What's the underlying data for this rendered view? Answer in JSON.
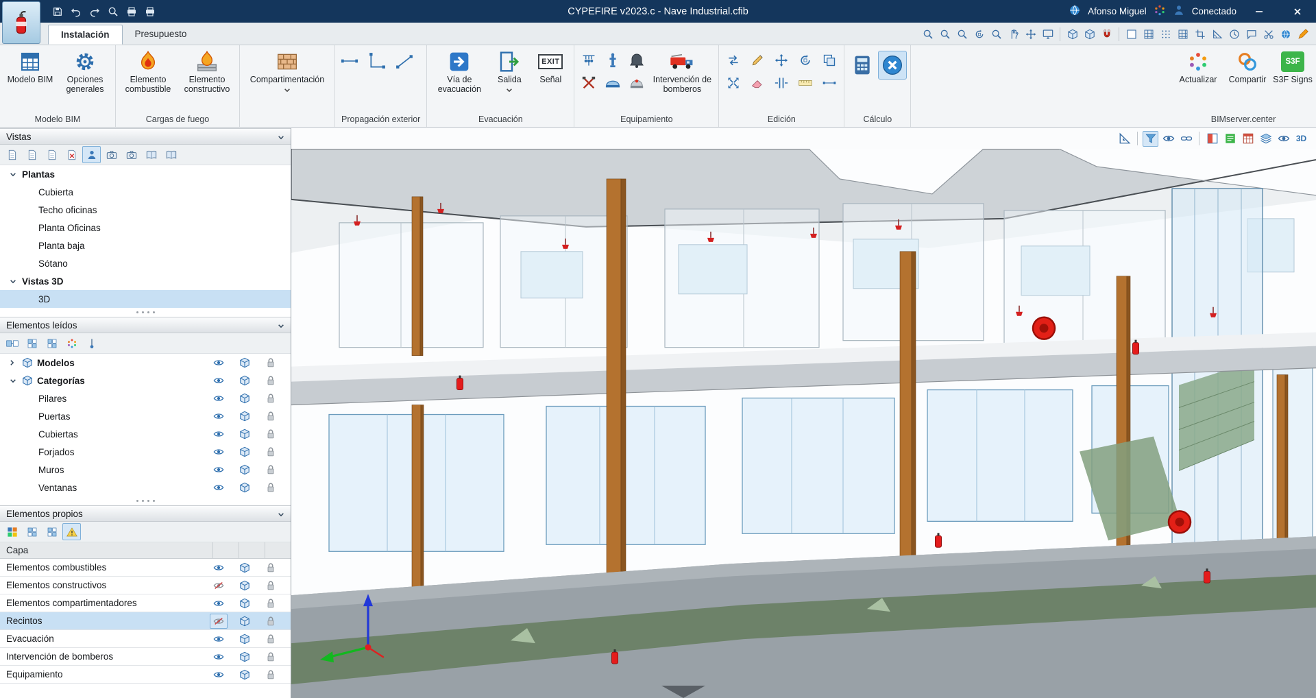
{
  "titlebar": {
    "title": "CYPEFIRE v2023.c - Nave Industrial.cfib",
    "user": "Afonso Miguel",
    "connection": "Conectado"
  },
  "tabs": {
    "instalacion": "Instalación",
    "presupuesto": "Presupuesto"
  },
  "ribbon": {
    "modelo_bim": {
      "label": "Modelo BIM",
      "btn_modelo": "Modelo BIM",
      "btn_opciones": "Opciones generales"
    },
    "cargas": {
      "label": "Cargas de fuego",
      "btn_combustible": "Elemento combustible",
      "btn_constructivo": "Elemento constructivo"
    },
    "compartimentacion": {
      "btn": "Compartimentación"
    },
    "propagacion": {
      "label": "Propagación exterior"
    },
    "evacuacion": {
      "label": "Evacuación",
      "btn_via": "Vía de evacuación",
      "btn_salida": "Salida",
      "btn_senal": "Señal",
      "exit_text": "EXIT"
    },
    "equipamiento": {
      "label": "Equipamiento",
      "btn_bomberos": "Intervención de bomberos"
    },
    "edicion": {
      "label": "Edición"
    },
    "calculo": {
      "label": "Cálculo"
    },
    "bimserver": {
      "label": "BIMserver.center",
      "btn_actualizar": "Actualizar",
      "btn_compartir": "Compartir",
      "btn_s3f": "S3F Signs",
      "s3f_badge": "S3F"
    }
  },
  "sidebar": {
    "vistas": {
      "title": "Vistas",
      "plantas_label": "Plantas",
      "plantas": [
        "Cubierta",
        "Techo oficinas",
        "Planta Oficinas",
        "Planta baja",
        "Sótano"
      ],
      "vistas3d_label": "Vistas 3D",
      "view3d": "3D"
    },
    "leidos": {
      "title": "Elementos leídos",
      "modelos_label": "Modelos",
      "categorias_label": "Categorías",
      "categorias": [
        "Pilares",
        "Puertas",
        "Cubiertas",
        "Forjados",
        "Muros",
        "Ventanas"
      ]
    },
    "propios": {
      "title": "Elementos propios",
      "col_capa": "Capa",
      "rows": [
        "Elementos combustibles",
        "Elementos constructivos",
        "Elementos compartimentadores",
        "Recintos",
        "Evacuación",
        "Intervención de bomberos",
        "Equipamiento"
      ]
    }
  },
  "viewport": {
    "view3d_badge": "3D"
  },
  "colors": {
    "titlebar_blue": "#14365c",
    "accent_blue": "#2e6fae",
    "selection_blue": "#c8e0f4",
    "fire_red": "#e02020",
    "column_brown": "#b4722f",
    "s3f_green": "#3db54a"
  }
}
